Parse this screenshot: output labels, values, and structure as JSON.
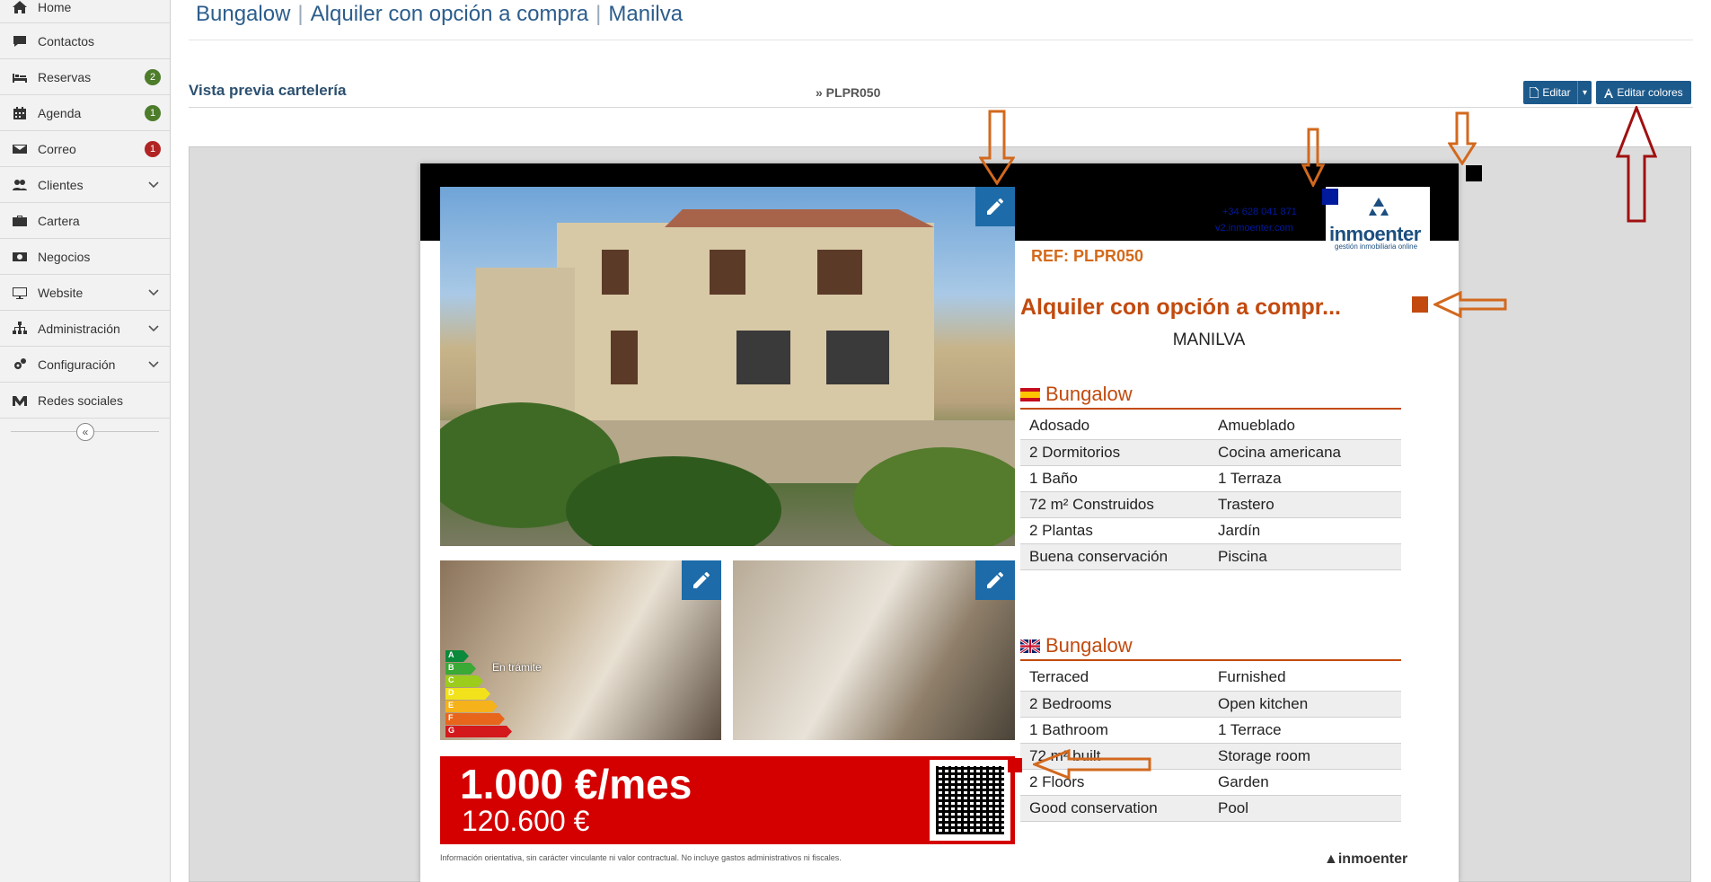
{
  "sidebar": {
    "items": [
      {
        "label": "Home",
        "icon": "home-icon"
      },
      {
        "label": "Contactos",
        "icon": "chat-icon"
      },
      {
        "label": "Reservas",
        "icon": "bed-icon",
        "badge": "2"
      },
      {
        "label": "Agenda",
        "icon": "calendar-icon",
        "badge": "1"
      },
      {
        "label": "Correo",
        "icon": "envelope-icon",
        "badge": "1"
      },
      {
        "label": "Clientes",
        "icon": "users-icon"
      },
      {
        "label": "Cartera",
        "icon": "briefcase-icon"
      },
      {
        "label": "Negocios",
        "icon": "money-icon"
      },
      {
        "label": "Website",
        "icon": "monitor-icon"
      },
      {
        "label": "Administración",
        "icon": "sitemap-icon"
      },
      {
        "label": "Configuración",
        "icon": "gears-icon"
      },
      {
        "label": "Redes sociales",
        "icon": "social-icon"
      }
    ],
    "collapse_glyph": "«"
  },
  "header": {
    "title_type": "Bungalow",
    "title_operation": "Alquiler con opción a compra",
    "title_city": "Manilva",
    "ref": "» PLPR050",
    "sep": "|"
  },
  "section": {
    "title": "Vista previa cartelería",
    "edit_label": "Editar",
    "caret": "▾",
    "colors_label": "Editar colores"
  },
  "poster": {
    "contact_phone": "+34 628 041 871",
    "contact_web": "v2.inmoenter.com",
    "logo_name": "inmoenter",
    "logo_tagline": "gestión inmobiliaria online",
    "ref": "REF: PLPR050",
    "headline": "Alquiler con opción a compr...",
    "city": "MANILVA",
    "energy_labels": [
      "A",
      "B",
      "C",
      "D",
      "E",
      "F",
      "G"
    ],
    "energy_colors": [
      "#0a8a3a",
      "#3aa935",
      "#9ccc1c",
      "#f2e21b",
      "#f6b21a",
      "#e8661c",
      "#d3191c"
    ],
    "tramite": "En trámite",
    "price_main": "1.000 €/mes",
    "price_sub": "120.600 €",
    "disclaimer": "Información orientativa, sin carácter vinculante ni valor contractual. No incluye gastos administrativos ni fiscales.",
    "footer_brand": "inmoenter",
    "es": {
      "title": "Bungalow",
      "rows": [
        [
          "Adosado",
          "Amueblado"
        ],
        [
          "2 Dormitorios",
          "Cocina americana"
        ],
        [
          "1 Baño",
          "1 Terraza"
        ],
        [
          "72 m² Construidos",
          "Trastero"
        ],
        [
          "2 Plantas",
          "Jardín"
        ],
        [
          "Buena conservación",
          "Piscina"
        ]
      ]
    },
    "en": {
      "title": "Bungalow",
      "rows": [
        [
          "Terraced",
          "Furnished"
        ],
        [
          "2 Bedrooms",
          "Open kitchen"
        ],
        [
          "1 Bathroom",
          "1 Terrace"
        ],
        [
          "72 m² built",
          "Storage room"
        ],
        [
          "2 Floors",
          "Garden"
        ],
        [
          "Good conservation",
          "Pool"
        ]
      ]
    },
    "swatch_colors": {
      "top_bar": "#000000",
      "contact": "#001a9e",
      "headline": "#c24a0e",
      "price": "#d40000"
    }
  },
  "colors": {
    "accent": "#1d5a8c",
    "arrow_orange": "#d2691e",
    "arrow_red": "#a01010"
  }
}
